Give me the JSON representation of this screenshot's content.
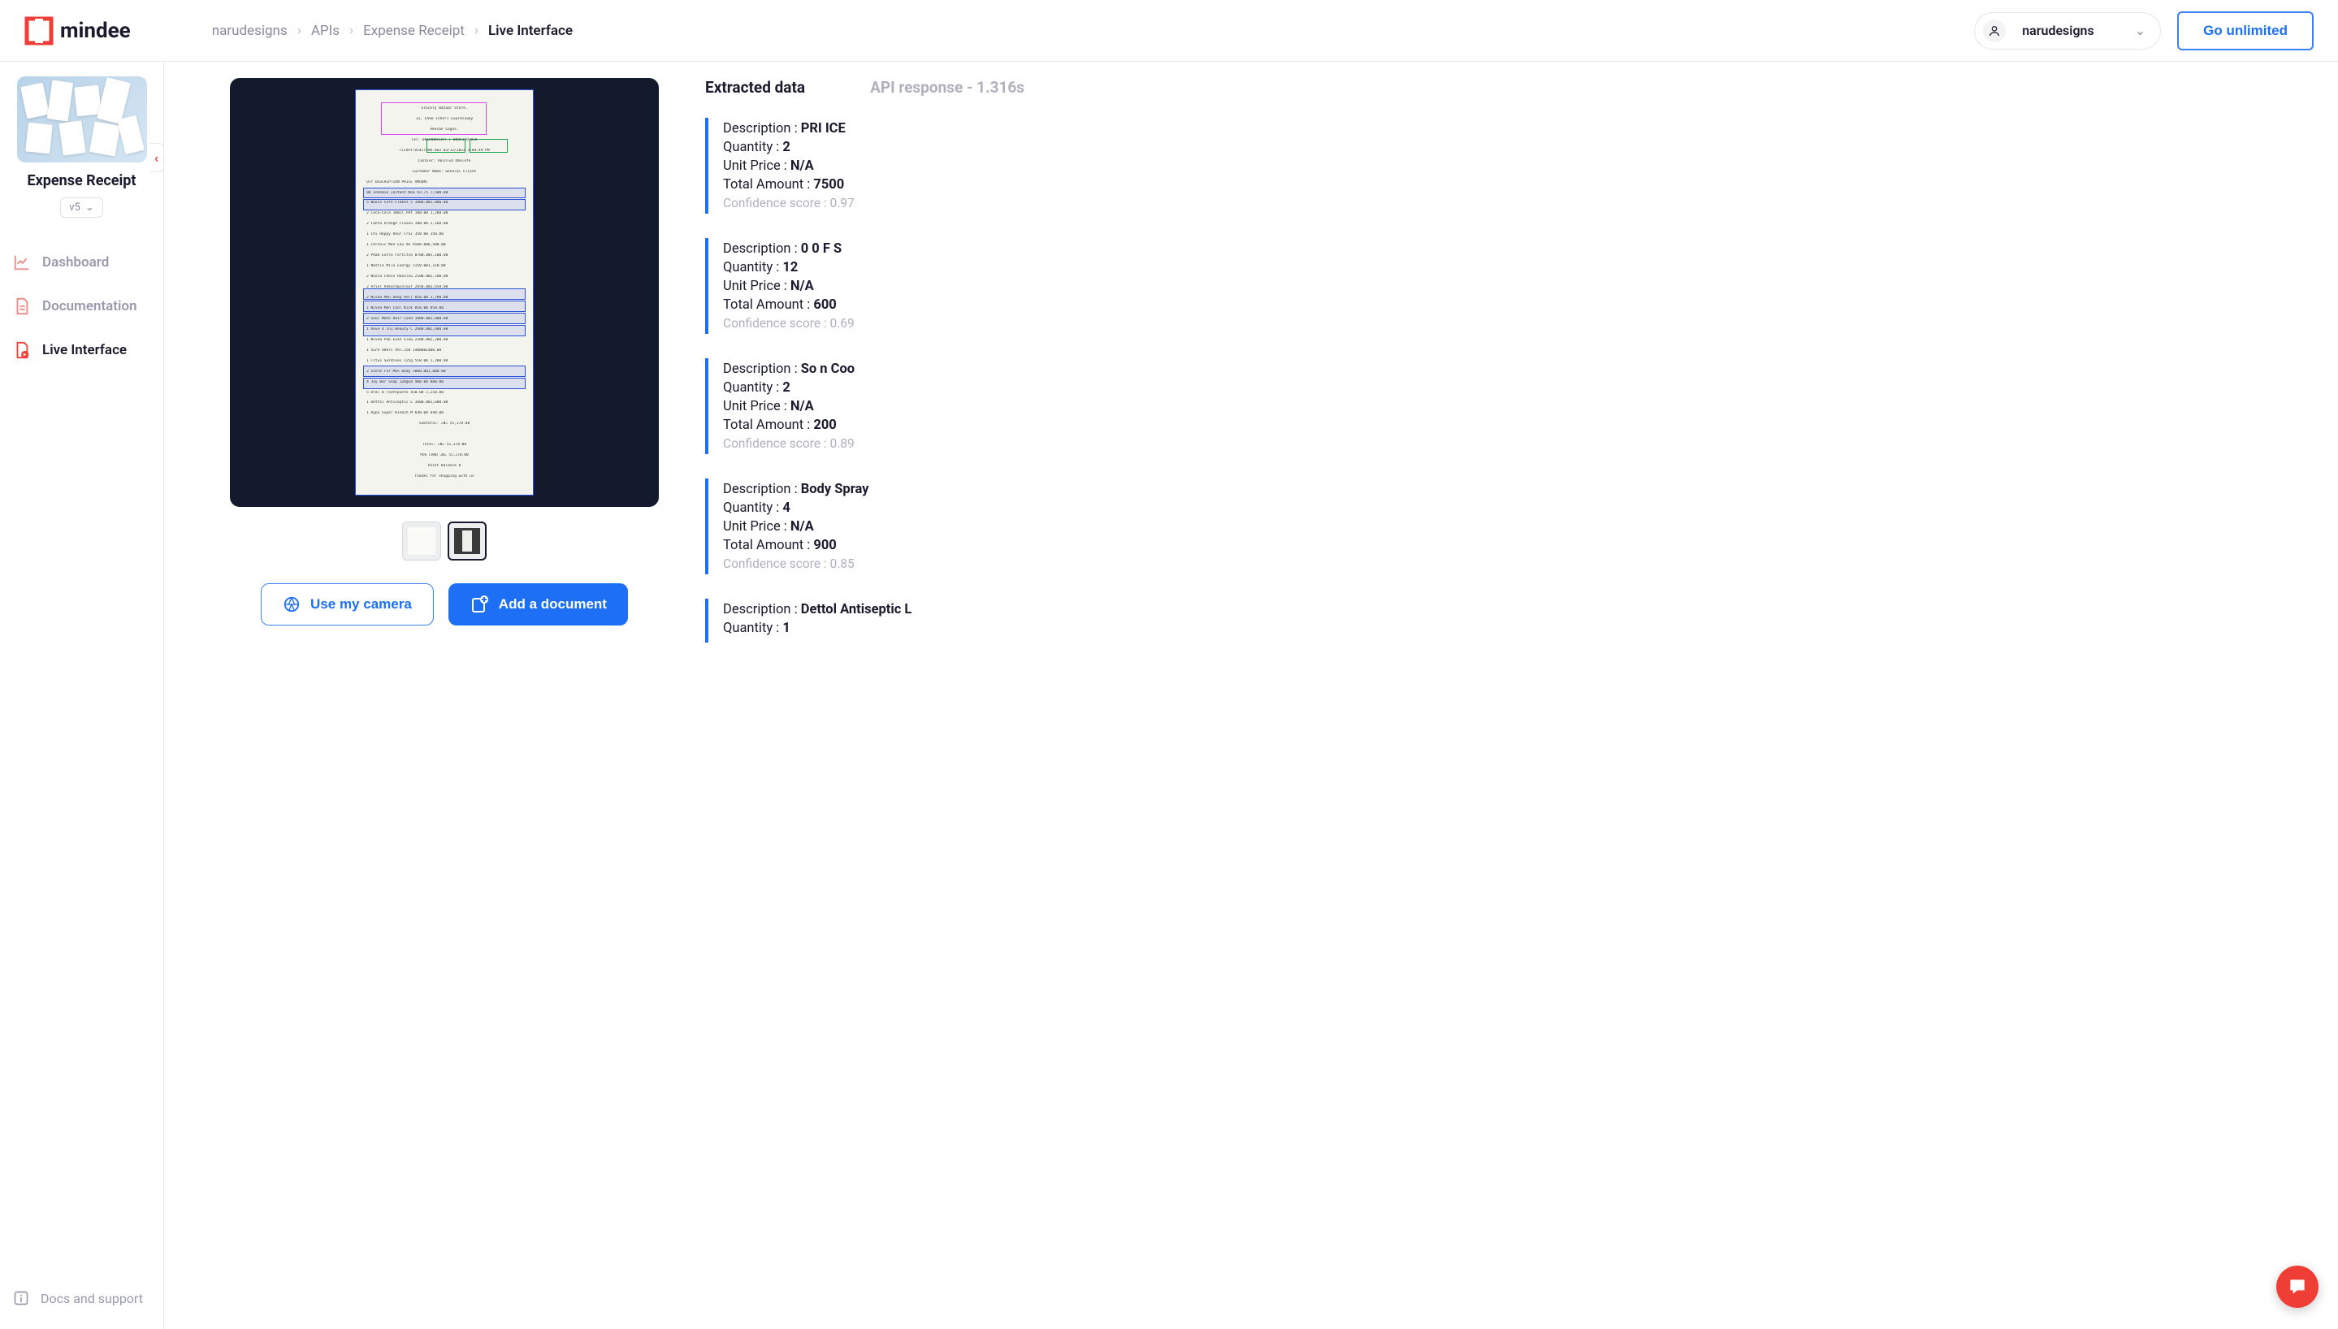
{
  "brand": "mindee",
  "breadcrumb": [
    "narudesigns",
    "APIs",
    "Expense Receipt",
    "Live Interface"
  ],
  "user": {
    "name": "narudesigns"
  },
  "cta": "Go unlimited",
  "sidebar": {
    "title": "Expense Receipt",
    "version": "v5",
    "nav": [
      {
        "label": "Dashboard",
        "icon": "chart-line-icon"
      },
      {
        "label": "Documentation",
        "icon": "document-icon"
      },
      {
        "label": "Live Interface",
        "icon": "play-badge-icon",
        "active": true
      }
    ],
    "footer": "Docs and support"
  },
  "actions": {
    "camera": "Use my camera",
    "add": "Add a document"
  },
  "tabs": {
    "extracted": "Extracted data",
    "api": "API response - 1.316s"
  },
  "receipt_lines": [
    "Grocery Bazaar Store.",
    "13, LASU Isheri Expressway",
    "Akesan Lagos.",
    "Tel: 08150891197 | 08053597018",
    "Ticket:01417598.403  03/12/2022  3:04:49 PM",
    "Cashier: Akinlua Omolofe",
    "Customer Name: General Client",
    "QTY DESCRIPTION        PRICE AMOUNT",
    "80  Indomie Instant Noo 93.75 7,500.00",
    "5   Nasco Corn Flakes 5 1800.001,800.00",
    "2   Coca-Cola 100cl Pet 180.00 1,260.00",
    "2   Fanta Orange Flavou 180.00 2,160.00",
    "1   Chi Happy Hour Frui 350.00 350.00",
    "1   Chronic Men Eau de  6500.006,500.00",
    "2   Peak Extra Fortifie 8700.005,100.00",
    "1   Nestle Milo Energy  1150.001,150.00",
    "2   Nussa Choco Hazelnu 2100.002,100.00",
    "2   Ariel Ankara&Colour 2650.002,650.00",
    "2   Nivea Men Deep Roll 850.00 1,700.00",
    "1   Nivea Men Cool Kick 850.00  850.00",
    "2   Soul Mate Hair Cond 1000.001,000.00",
    "1   Dove 4 in1 Beauty C 2600.002,600.00",
    "1   Nivea Pob Even Glow 2200.002,200.00",
    "1   Sure 48hrs 497.250 1400001400.00",
    "1   Titus Sardines 125g 550.00 2,200.00",
    "2   Storm For Men Body  1800.001,800.00",
    "4   Joy Bar Soap 120gx4 400.00  800.00",
    "5   Oral B Toothpaste   450.00 2,250.00",
    "1   Dettol Antiseptic L 1600.001,600.00",
    "1   Hypo Super Bleach M 640.00  640.00",
    "              Subtotal: =N=  55,170.00",
    "",
    "              Total:    =N=  55,170.00",
    "              POS CARD  =N=  55,170.00",
    "        Point Balance   0",
    "     Thanks for shopping with us"
  ],
  "line_items": [
    {
      "description": "PRI ICE",
      "quantity": "2",
      "unit_price": "N/A",
      "total_amount": "7500",
      "confidence": "0.97"
    },
    {
      "description": "0 0 F S",
      "quantity": "12",
      "unit_price": "N/A",
      "total_amount": "600",
      "confidence": "0.69"
    },
    {
      "description": "So n Coo",
      "quantity": "2",
      "unit_price": "N/A",
      "total_amount": "200",
      "confidence": "0.89"
    },
    {
      "description": "Body Spray",
      "quantity": "4",
      "unit_price": "N/A",
      "total_amount": "900",
      "confidence": "0.85"
    },
    {
      "description": "Dettol Antiseptic L",
      "quantity": "1"
    }
  ],
  "labels": {
    "description": "Description : ",
    "quantity": "Quantity : ",
    "unit_price": "Unit Price : ",
    "total_amount": "Total Amount : ",
    "confidence": "Confidence score : "
  }
}
